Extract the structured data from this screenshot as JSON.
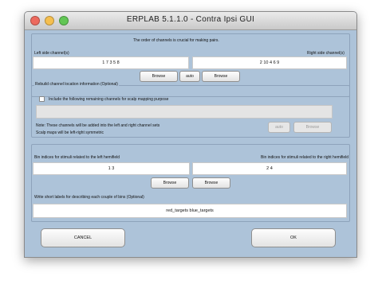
{
  "window": {
    "title": "ERPLAB 5.1.1.0  -  Contra Ipsi GUI"
  },
  "channels": {
    "hint": "The order of channels is crucial for making pairs.",
    "left_label": "Left side channel(s)",
    "right_label": "Right side channel(s)",
    "left_value": "1 7 3 5 8",
    "right_value": "2 10 4 6 9",
    "browse_left": "Browse",
    "auto": "auto",
    "browse_right": "Browse"
  },
  "rebuild": {
    "legend": "Rebuild channel location information (Optional)",
    "checkbox_label": "Include the following remaining channels for scalp mapping purpose",
    "checked": false,
    "field_value": "",
    "note_line1": "Note: These channels will be added into the left and right channel sets",
    "note_line2": "Scalp maps will be left-right symmetric",
    "auto": "auto",
    "browse": "Browse"
  },
  "bins": {
    "left_label": "Bin indices for stimuli related to the left hemifield",
    "right_label": "Bin indices for stimuli related to the right hemifield",
    "left_value": "1 3",
    "right_value": "2 4",
    "browse_left": "Browse",
    "browse_right": "Browse",
    "labels_prompt": "Write short labels for describing each couple of bins (Optional)",
    "labels_value": "red_targets blue_targets"
  },
  "footer": {
    "cancel": "CANCEL",
    "ok": "OK"
  }
}
